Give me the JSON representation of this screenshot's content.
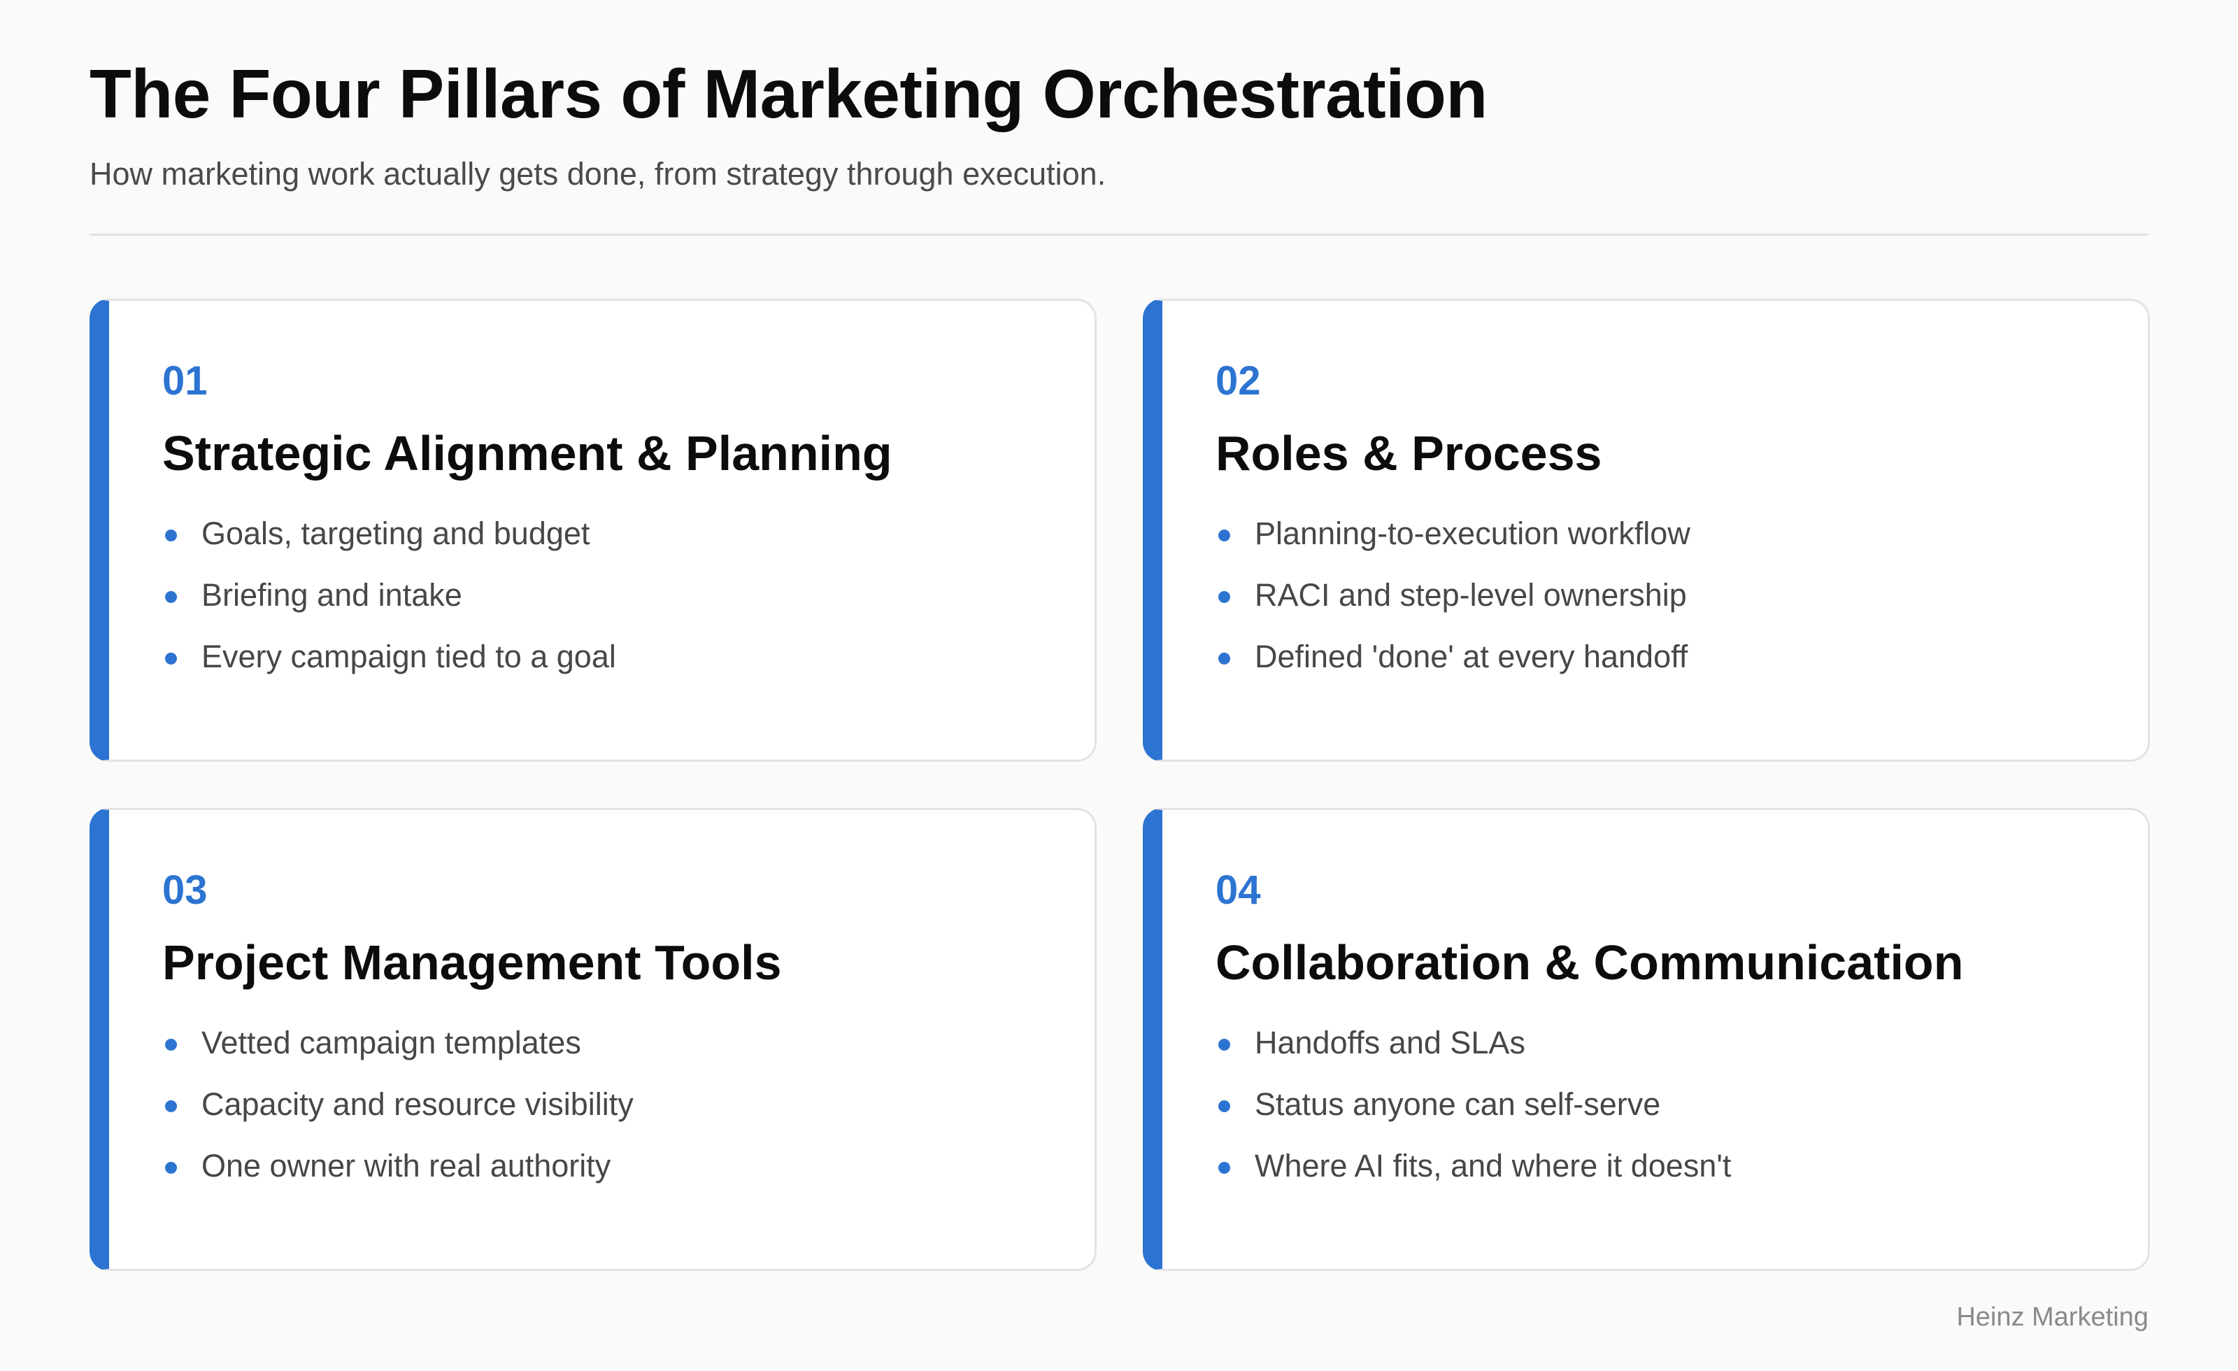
{
  "header": {
    "title": "The Four Pillars of Marketing Orchestration",
    "subtitle": "How marketing work actually gets done, from strategy through execution."
  },
  "pillars": [
    {
      "number": "01",
      "title": "Strategic Alignment & Planning",
      "items": [
        "Goals, targeting and budget",
        "Briefing and intake",
        "Every campaign tied to a goal"
      ]
    },
    {
      "number": "02",
      "title": "Roles & Process",
      "items": [
        "Planning-to-execution workflow",
        "RACI and step-level ownership",
        "Defined 'done' at every handoff"
      ]
    },
    {
      "number": "03",
      "title": "Project Management Tools",
      "items": [
        "Vetted campaign templates",
        "Capacity and resource visibility",
        "One owner with real authority"
      ]
    },
    {
      "number": "04",
      "title": "Collaboration & Communication",
      "items": [
        "Handoffs and SLAs",
        "Status anyone can self-serve",
        "Where AI fits, and where it doesn't"
      ]
    }
  ],
  "footer": {
    "credit": "Heinz Marketing"
  },
  "colors": {
    "accent": "#2d74d2",
    "background": "#fafaf8",
    "card": "#ffffff",
    "border": "#e3e3e3"
  }
}
